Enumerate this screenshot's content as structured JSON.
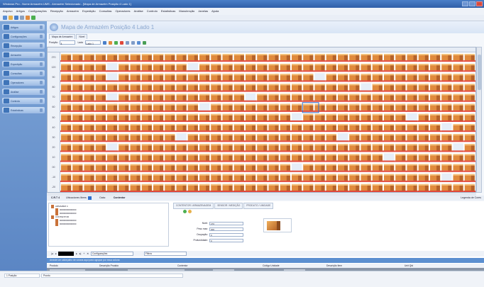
{
  "window": {
    "title": "Windows Pro - Nome Armazém UMS - Armazém Selecionado - [Mapa de Armazém Posição 4 Lado 1]"
  },
  "menu": [
    "Arquivo",
    "Artigos",
    "Configurações",
    "Recepção",
    "Armazém",
    "Expedição",
    "Consultas",
    "Operadores",
    "Análise",
    "Controlo",
    "Estatísticas",
    "Manutenção",
    "Janelas",
    "Ajuda"
  ],
  "sidebar": {
    "items": [
      "Artigos",
      "Configurações",
      "Recepção",
      "Armazém",
      "Expedição",
      "Consultas",
      "Operadores",
      "Análise",
      "Controlo",
      "Estatísticas"
    ]
  },
  "page": {
    "title": "Mapa de Armazém Posição 4 Lado 1",
    "tab": "Mapa de Armazém",
    "tab2": "Nível",
    "filter_label1": "Posição",
    "filter_value1": "4",
    "filter_label2": "Lado",
    "filter_value2": "Lado 1"
  },
  "grid": {
    "row_labels": [
      "270",
      "120",
      "90",
      "80",
      "70",
      "60",
      "50",
      "40",
      "30",
      "20",
      "10",
      "00",
      "-10",
      "-20"
    ]
  },
  "infobar": {
    "label1": "C.R.T 4",
    "label2": "Ubicaciones libres:",
    "label3": "Data:",
    "label4": "Contentor",
    "right": "Legenda de Cores"
  },
  "tree": {
    "nodes": [
      "ARMAZÉM 4",
      "00000000000000",
      "00000000000000",
      "CONTENTOR",
      "00000000000000",
      "00000000000000"
    ]
  },
  "detail_tabs": [
    "CONTENTOR / ARMAZENAGEM",
    "SENSOR / MEDIÇÃO",
    "PRODUTO / UNIDADE"
  ],
  "fields": [
    {
      "label": "Nivel:",
      "value": "270"
    },
    {
      "label": "Peso max:",
      "value": "300"
    },
    {
      "label": "Ocupação:",
      "value": "0"
    },
    {
      "label": "Profundidade:",
      "value": "0"
    }
  ],
  "nav": {
    "config_label": "Configurações",
    "filter_label": "Filtros"
  },
  "bluebar": {
    "text": "Arraste um cabeçalho de coluna aqui para agrupar por essa coluna"
  },
  "table": {
    "headers": [
      "Produto",
      "Descrição Produto",
      "Contentor",
      "Código Unidade",
      "Descrição Item",
      "Unit Qtd"
    ]
  },
  "status": {
    "cell1": "1 Posição",
    "cell2": "Pronto"
  },
  "colors": {
    "accent": "#2f5fa8",
    "box_orange": "#e08a3c",
    "box_red": "#e0483a",
    "empty_slot": "#e6edf7"
  }
}
